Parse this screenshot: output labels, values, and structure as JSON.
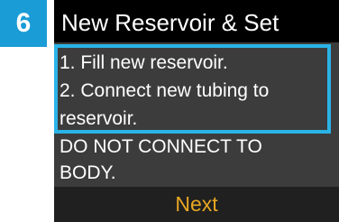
{
  "step": {
    "number": "6",
    "badge_color": "#1a9cd6"
  },
  "screen": {
    "title": "New Reservoir & Set",
    "instructions": [
      "1. Fill new reservoir.",
      "2. Connect new tubing to",
      "reservoir.",
      "DO NOT CONNECT TO",
      "BODY."
    ],
    "highlighted_lines": [
      0,
      1,
      2
    ],
    "highlight_color": "#2ab3e6",
    "next_label": "Next",
    "next_color": "#e8a722"
  }
}
